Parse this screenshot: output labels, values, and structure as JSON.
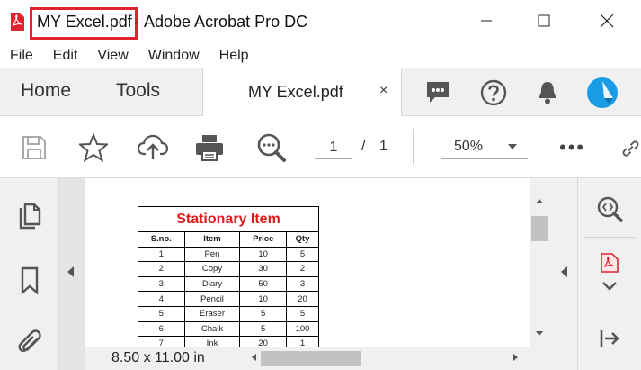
{
  "window": {
    "document_title": "MY Excel.pdf",
    "separator": "-",
    "app_title": "Adobe Acrobat Pro DC"
  },
  "menu": [
    "File",
    "Edit",
    "View",
    "Window",
    "Help"
  ],
  "tabs": {
    "home": "Home",
    "tools": "Tools",
    "document": "MY Excel.pdf",
    "close_glyph": "×"
  },
  "toolbar": {
    "page_current": "1",
    "page_separator": "/",
    "page_total": "1",
    "zoom": "50%",
    "more": "•••"
  },
  "icons": {
    "save": "save-icon",
    "bookmark": "star-icon",
    "upload": "cloud-upload-icon",
    "print": "printer-icon",
    "search": "magnifier-icon",
    "comments": "chat-icon",
    "help": "help-icon",
    "notifications": "bell-icon",
    "account": "avatar"
  },
  "document": {
    "table_title": "Stationary Item",
    "columns": [
      "S.no.",
      "Item",
      "Price",
      "Qty"
    ],
    "rows": [
      [
        "1",
        "Pen",
        "10",
        "5"
      ],
      [
        "2",
        "Copy",
        "30",
        "2"
      ],
      [
        "3",
        "Diary",
        "50",
        "3"
      ],
      [
        "4",
        "Pencil",
        "10",
        "20"
      ],
      [
        "5",
        "Eraser",
        "5",
        "5"
      ],
      [
        "6",
        "Chalk",
        "5",
        "100"
      ],
      [
        "7",
        "Ink",
        "20",
        "1"
      ]
    ]
  },
  "status": {
    "page_size": "8.50 x 11.00 in"
  },
  "colors": {
    "highlight": "#e0242f",
    "table_title": "#e01b1b",
    "pdf_red": "#e0242f",
    "avatar_blue": "#1a9be6"
  }
}
